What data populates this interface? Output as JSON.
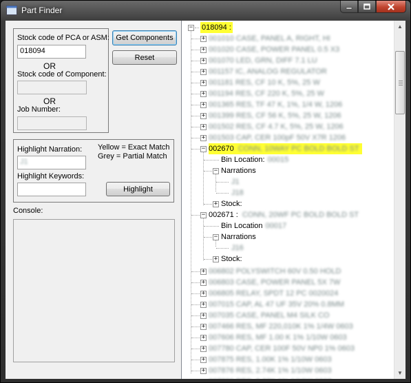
{
  "window": {
    "title": "Part Finder"
  },
  "search_group": {
    "pca_label": "Stock code of PCA or ASM:",
    "pca_value": "018094",
    "or1": "OR",
    "component_label": "Stock code of Component:",
    "component_value": "",
    "or2": "OR",
    "job_label": "Job Number:",
    "job_value": ""
  },
  "buttons": {
    "get_components": "Get Components",
    "reset": "Reset",
    "highlight": "Highlight"
  },
  "highlight_group": {
    "narration_label": "Highlight Narration:",
    "narration_value": "J1",
    "keywords_label": "Highlight Keywords:",
    "keywords_value": "",
    "legend_yellow": "Yellow = Exact Match",
    "legend_grey": "Grey = Partial Match"
  },
  "console": {
    "label": "Console:"
  },
  "tree": {
    "root": "018094 :",
    "rows_before": [
      "001010  CASE, PANEL A, RIGHT, HI",
      "001020  CASE, POWER PANEL 0.5 X3",
      "001070  LED, GRN, DIFF  7.1 LU",
      "001157  IC, ANALOG  REGULATOR",
      "001181  RES, CF   10 K, 5%, 25 W",
      "001194  RES, CF   220 K, 5%, 25 W",
      "001365  RES, TF  47 K, 1%, 1/4 W, 1206",
      "001399  RES, CF   56 K, 5%, 25 W, 1206",
      "001502  RES, CF  4.7 K, 5%, 25 W, 1206",
      "001503  CAP, CER  100pF 50V X7R 1206"
    ],
    "exp1": {
      "code": "002670",
      "desc": "CONN, 10WAY PC BOLD BOLD ST",
      "bin_label": "Bin Location:",
      "bin_value": "00015",
      "narrations_label": "Narrations",
      "narrations": [
        "J1",
        "J18"
      ],
      "stock_label": "Stock:"
    },
    "exp2": {
      "code": "002671 :",
      "desc": "CONN, 20WF PC BOLD BOLD ST",
      "bin_label": "Bin Location",
      "bin_value": "00017",
      "narrations_label": "Narrations",
      "narrations": [
        "J16"
      ],
      "stock_label": "Stock:"
    },
    "rows_after": [
      "006802  POLYSWITCH  60V  0.50 HOLD",
      "006803  CASE, POWER  PANEL 5X 7W",
      "006805  RELAY, SPDT  12 PC 0020024",
      "007015  CAP, AL  47 UF  35V 20% 0.8MM",
      "007035  CASE, PANEL  M4 SILK CO",
      "007466  RES, MF  220,010K  1%  1/4W 0603",
      "007606  RES, MF  1.00 K  1%  1/10W 0603",
      "007780  CAP, CER 100F 50V NP0 1% 0603",
      "007875  RES,  1.00K  1%  1/10W 0603",
      "007876  RES,  2.74K  1%  1/10W 0603",
      "007880  RES,  3.32K  1%  1/10W 0603"
    ]
  },
  "colors": {
    "highlight_yellow": "#ffff33",
    "title_bar": "#3c3c3c",
    "close_button": "#c0442f"
  },
  "icons": {
    "app": "window-app-icon",
    "minimize": "minimize-icon",
    "maximize": "maximize-icon",
    "close": "close-icon"
  }
}
